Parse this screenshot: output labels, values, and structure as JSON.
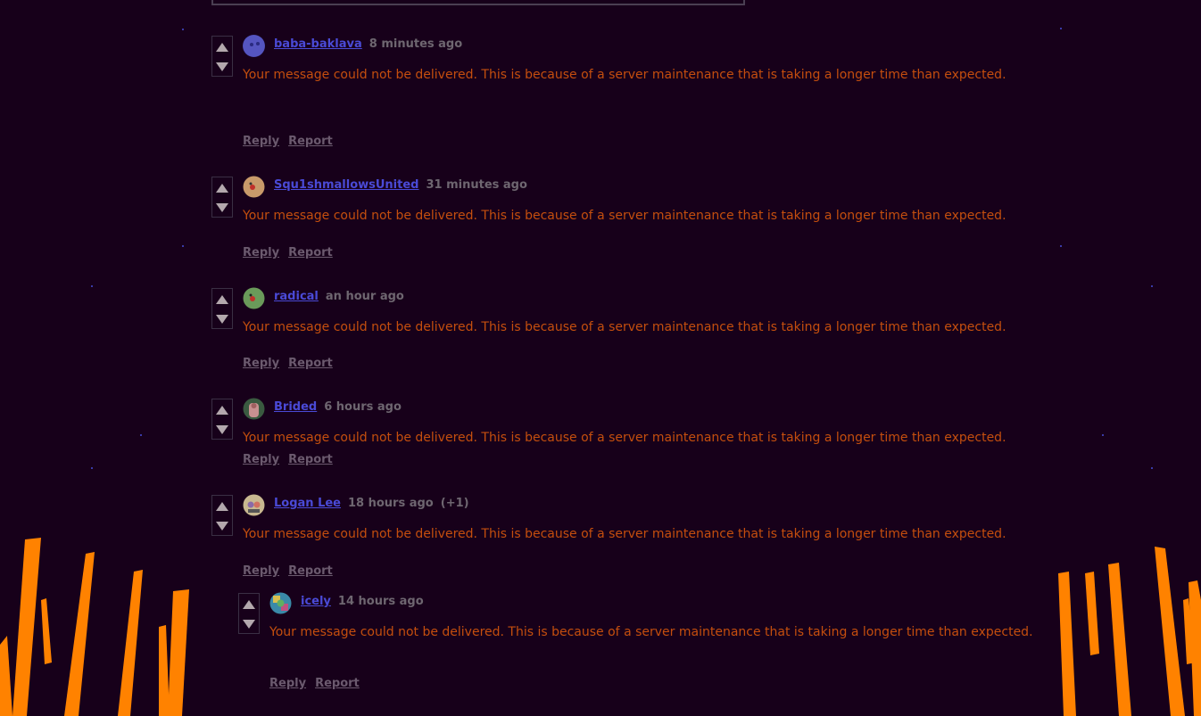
{
  "colors": {
    "background": "#17001a",
    "username": "#4a4ad6",
    "message": "#c44e0e",
    "timestamp": "#6e6670",
    "action": "#6b5a6e",
    "flame": "#ff8200"
  },
  "comments": [
    {
      "username": "baba-baklava",
      "time": "8 minutes ago",
      "message": "Your message could not be delivered. This is because of a server maintenance that is taking a longer time than expected.",
      "reply": "Reply",
      "report": "Report",
      "avatar_icon": "blue-face-avatar"
    },
    {
      "username": "Squ1shmallowsUnited",
      "time": "31 minutes ago",
      "message": "Your message could not be delivered. This is because of a server maintenance that is taking a longer time than expected.",
      "reply": "Reply",
      "report": "Report",
      "avatar_icon": "peach-face-avatar"
    },
    {
      "username": "radical",
      "time": "an hour ago",
      "message": "Your message could not be delivered. This is because of a server maintenance that is taking a longer time than expected.",
      "reply": "Reply",
      "report": "Report",
      "avatar_icon": "green-face-avatar"
    },
    {
      "username": "Brided",
      "time": "6 hours ago",
      "message": "Your message could not be delivered. This is because of a server maintenance that is taking a longer time than expected.",
      "reply": "Reply",
      "report": "Report",
      "avatar_icon": "bride-avatar"
    },
    {
      "username": "Logan Lee",
      "time": "18 hours ago",
      "badge": "(+1)",
      "message": "Your message could not be delivered. This is because of a server maintenance that is taking a longer time than expected.",
      "reply": "Reply",
      "report": "Report",
      "avatar_icon": "cartoon-avatar"
    },
    {
      "username": "icely",
      "time": "14 hours ago",
      "message": "Your message could not be delivered. This is because of a server maintenance that is taking a longer time than expected.",
      "reply": "Reply",
      "report": "Report",
      "avatar_icon": "colorful-avatar",
      "is_reply": true
    }
  ]
}
